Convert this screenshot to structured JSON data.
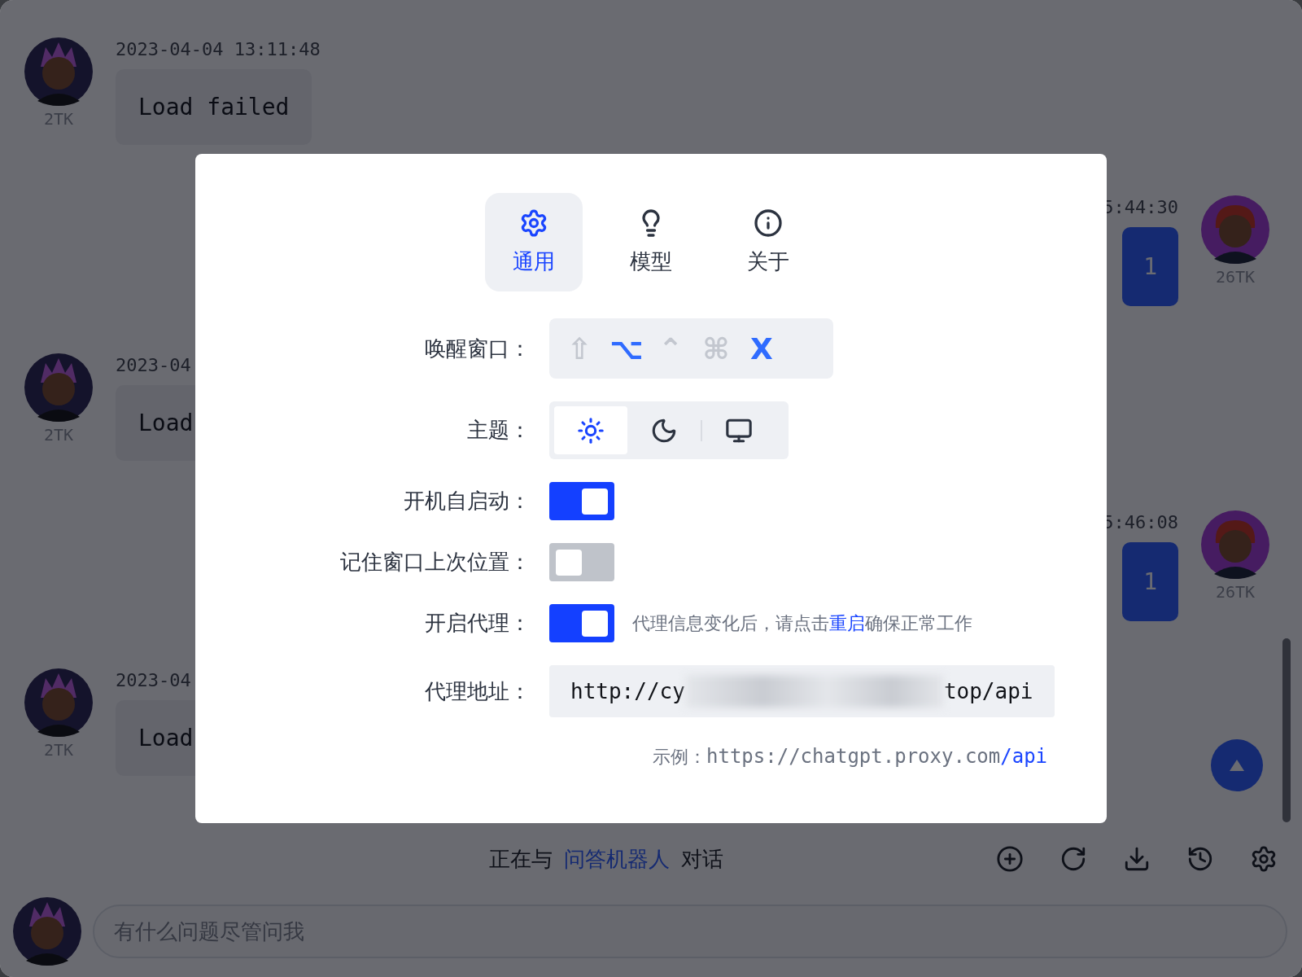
{
  "messages": [
    {
      "kind": "incoming",
      "time": "2023-04-04 13:11:48",
      "text": "Load failed",
      "tokens": "2TK"
    },
    {
      "kind": "outgoing",
      "time": "5:44:30",
      "text": "1",
      "tokens": "26TK"
    },
    {
      "kind": "incoming",
      "time": "2023-04",
      "text": "Load",
      "tokens": "2TK"
    },
    {
      "kind": "outgoing",
      "time": "5:46:08",
      "text": "1",
      "tokens": "26TK"
    },
    {
      "kind": "incoming",
      "time": "2023-04",
      "text": "Load",
      "tokens": "2TK"
    }
  ],
  "status": {
    "prefix": "正在与",
    "bot": "问答机器人",
    "suffix": "对话"
  },
  "input": {
    "placeholder": "有什么问题尽管问我"
  },
  "settings": {
    "tabs": [
      {
        "label": "通用",
        "selected": true
      },
      {
        "label": "模型",
        "selected": false
      },
      {
        "label": "关于",
        "selected": false
      }
    ],
    "rows": [
      {
        "kind": "hotkey",
        "label": "唤醒窗口：",
        "keys": [
          {
            "key": "⇧",
            "on": false
          },
          {
            "key": "⌥",
            "on": true
          },
          {
            "key": "⌃",
            "on": false
          },
          {
            "key": "⌘",
            "on": false
          },
          {
            "key": "X",
            "on": true
          }
        ]
      },
      {
        "kind": "theme",
        "label": "主题：",
        "options": [
          {
            "selected": true
          },
          {
            "selected": false
          },
          {
            "selected": false
          }
        ]
      },
      {
        "kind": "toggle",
        "label": "开机自启动：",
        "on": true
      },
      {
        "kind": "toggle",
        "label": "记住窗口上次位置：",
        "on": false
      },
      {
        "kind": "toggle",
        "label": "开启代理：",
        "on": true,
        "hint": {
          "before": "代理信息变化后，请点击",
          "link": "重启",
          "after": "确保正常工作"
        }
      },
      {
        "kind": "field",
        "label": "代理地址：",
        "value_start": "http://cy",
        "value_end": "top/api",
        "example": {
          "label": "示例：",
          "url": "https://chatgpt.proxy.com",
          "highlight": "/api"
        }
      }
    ]
  }
}
